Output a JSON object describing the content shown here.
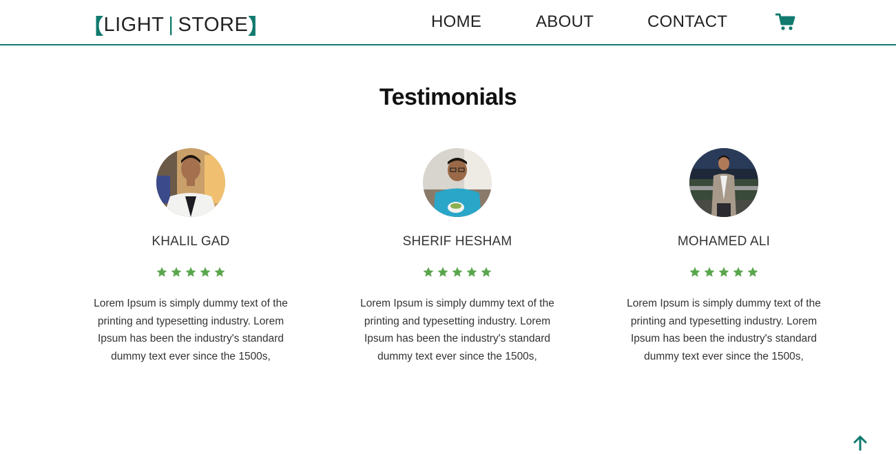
{
  "brand": {
    "open_bracket": "【",
    "left_word": "LIGHT",
    "separator": "|",
    "right_word": "STORE",
    "close_bracket": "】"
  },
  "nav": {
    "home": "HOME",
    "about": "ABOUT",
    "contact": "CONTACT",
    "cart_icon": "shopping-cart-icon"
  },
  "section": {
    "title": "Testimonials"
  },
  "testimonials": [
    {
      "name": "KHALIL GAD",
      "rating": 5,
      "text": "Lorem Ipsum is simply dummy text of the printing and typesetting industry. Lorem Ipsum has been the industry's standard dummy text ever since the 1500s,"
    },
    {
      "name": "SHERIF HESHAM",
      "rating": 5,
      "text": "Lorem Ipsum is simply dummy text of the printing and typesetting industry. Lorem Ipsum has been the industry's standard dummy text ever since the 1500s,"
    },
    {
      "name": "MOHAMED ALI",
      "rating": 5,
      "text": "Lorem Ipsum is simply dummy text of the printing and typesetting industry. Lorem Ipsum has been the industry's standard dummy text ever since the 1500s,"
    }
  ],
  "colors": {
    "accent": "#117a6f",
    "star": "#5aa64e",
    "text": "#333333"
  },
  "scroll_top_icon": "arrow-up-icon"
}
